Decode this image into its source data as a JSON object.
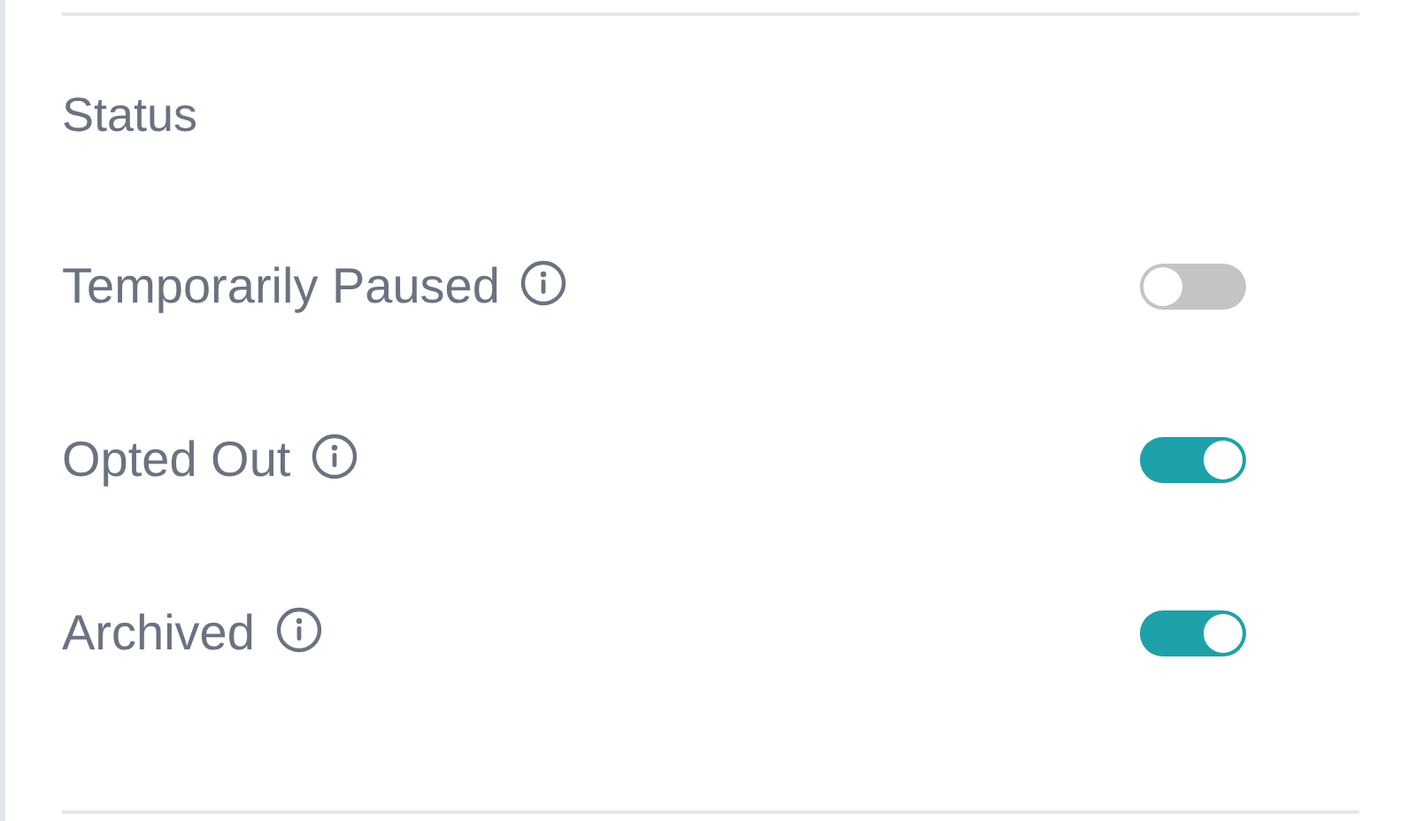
{
  "section": {
    "title": "Status"
  },
  "settings": [
    {
      "label": "Temporarily Paused",
      "on": false
    },
    {
      "label": "Opted Out",
      "on": true
    },
    {
      "label": "Archived",
      "on": true
    }
  ]
}
